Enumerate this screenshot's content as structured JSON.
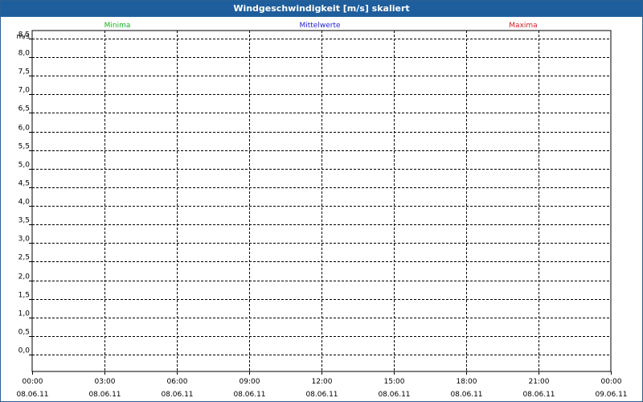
{
  "window": {
    "title": "Windgeschwindigkeit [m/s] skaliert"
  },
  "legend": {
    "min_label": "Minima",
    "min_color": "#22aa22",
    "mean_label": "Mittelwerte",
    "mean_color": "#2222cc",
    "max_label": "Maxima",
    "max_color": "#cc2222"
  },
  "chart_data": {
    "type": "line",
    "title": "Windgeschwindigkeit [m/s] skaliert",
    "ylabel": "m/s",
    "xlabel": "",
    "ylim": [
      -0.5,
      9.0
    ],
    "yticks": [
      "8,5",
      "8,0",
      "7,5",
      "7,0",
      "6,5",
      "6,0",
      "5,5",
      "5,0",
      "4,5",
      "4,0",
      "3,5",
      "3,0",
      "2,5",
      "2,0",
      "1,5",
      "1,0",
      "0,5",
      "0,0"
    ],
    "ytick_values": [
      8.5,
      8.0,
      7.5,
      7.0,
      6.5,
      6.0,
      5.5,
      5.0,
      4.5,
      4.0,
      3.5,
      3.0,
      2.5,
      2.0,
      1.5,
      1.0,
      0.5,
      0.0
    ],
    "xticks": [
      {
        "time": "00:00",
        "date": "08.06.11"
      },
      {
        "time": "03:00",
        "date": "08.06.11"
      },
      {
        "time": "06:00",
        "date": "08.06.11"
      },
      {
        "time": "09:00",
        "date": "08.06.11"
      },
      {
        "time": "12:00",
        "date": "08.06.11"
      },
      {
        "time": "15:00",
        "date": "08.06.11"
      },
      {
        "time": "18:00",
        "date": "08.06.11"
      },
      {
        "time": "21:00",
        "date": "08.06.11"
      },
      {
        "time": "00:00",
        "date": "09.06.11"
      }
    ],
    "grid": true,
    "legend_position": "top",
    "series": []
  }
}
